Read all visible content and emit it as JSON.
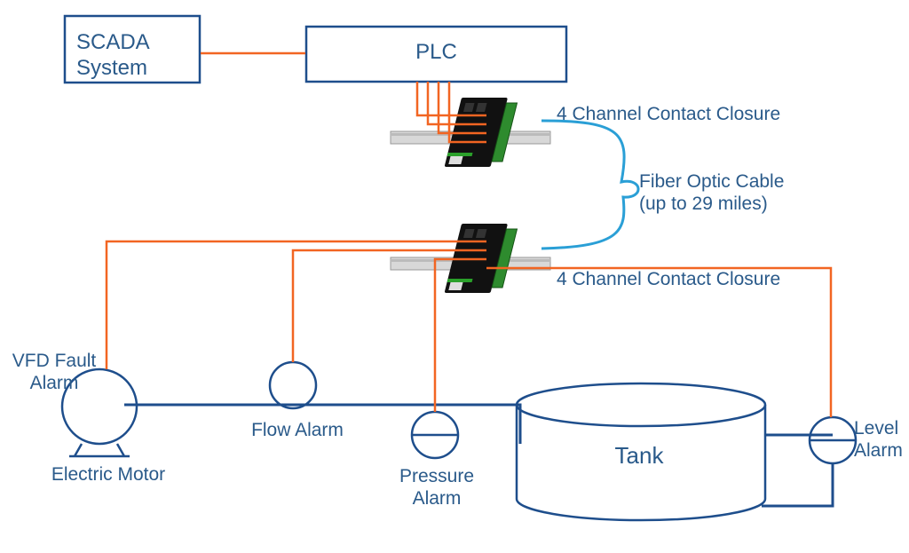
{
  "colors": {
    "outline": "#1e4e8c",
    "signal": "#f26522",
    "fiber": "#2a9fd6",
    "text": "#3a6ea5"
  },
  "nodes": {
    "scada": {
      "label": "SCADA\nSystem"
    },
    "plc": {
      "label": "PLC"
    },
    "cc_top": {
      "label": "4 Channel Contact Closure"
    },
    "fiber": {
      "label": "Fiber Optic Cable\n(up to 29 miles)"
    },
    "cc_bot": {
      "label": "4 Channel Contact Closure"
    },
    "vfd": {
      "label": "VFD Fault\nAlarm"
    },
    "motor": {
      "label": "Electric Motor"
    },
    "flow": {
      "label": "Flow Alarm"
    },
    "pressure": {
      "label": "Pressure\nAlarm"
    },
    "tank": {
      "label": "Tank"
    },
    "level": {
      "label": "Level\nAlarm"
    }
  }
}
